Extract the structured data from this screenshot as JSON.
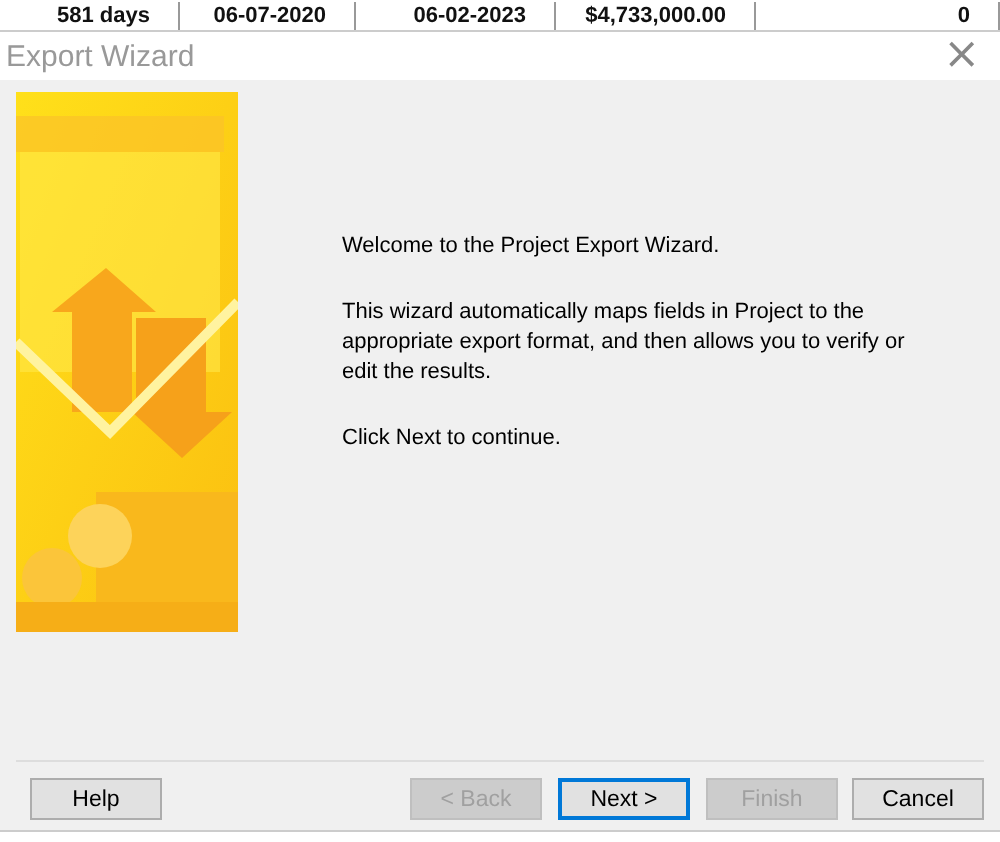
{
  "background_row": {
    "cells": [
      "581 days",
      "06-07-2020",
      "06-02-2023",
      "$4,733,000.00",
      "0"
    ]
  },
  "window": {
    "title": "Export Wizard",
    "close": "×"
  },
  "wizard": {
    "paragraphs": [
      "Welcome to the Project Export Wizard.",
      "This wizard automatically maps fields in Project to the appropriate export format, and then allows you to verify or edit the results.",
      "Click Next to continue."
    ]
  },
  "buttons": [
    {
      "label": "Help",
      "disabled": false,
      "default": false
    },
    {
      "label": "< Back",
      "disabled": true,
      "default": false
    },
    {
      "label": "Next >",
      "disabled": false,
      "default": true
    },
    {
      "label": "Finish",
      "disabled": true,
      "default": false
    },
    {
      "label": "Cancel",
      "disabled": false,
      "default": false
    }
  ]
}
